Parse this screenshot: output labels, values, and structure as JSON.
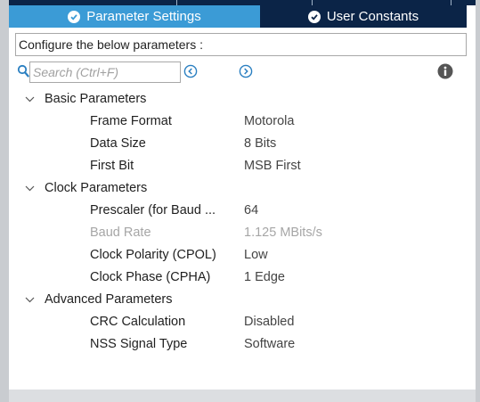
{
  "tabs": [
    {
      "label": "Parameter Settings",
      "active": true
    },
    {
      "label": "User Constants",
      "active": false
    }
  ],
  "config_label": "Configure the below parameters :",
  "search": {
    "placeholder": "Search (Ctrl+F)",
    "value": ""
  },
  "icons": {
    "search": "search-icon",
    "prev": "circle-chevron-left-icon",
    "next": "circle-chevron-right-icon",
    "info": "info-icon",
    "check": "check-circle-icon",
    "expand": "chevron-down-icon"
  },
  "colors": {
    "active_tab": "#3b9bd6",
    "inactive_tab": "#0b2447",
    "accent": "#3b9bd6",
    "disabled_text": "#a6a6a6"
  },
  "groups": [
    {
      "label": "Basic Parameters",
      "params": [
        {
          "name": "Frame Format",
          "value": "Motorola"
        },
        {
          "name": "Data Size",
          "value": "8 Bits"
        },
        {
          "name": "First Bit",
          "value": "MSB First"
        }
      ]
    },
    {
      "label": "Clock Parameters",
      "params": [
        {
          "name": "Prescaler (for Baud ...",
          "value": "64"
        },
        {
          "name": "Baud Rate",
          "value": "1.125 MBits/s",
          "disabled": true
        },
        {
          "name": "Clock Polarity (CPOL)",
          "value": "Low"
        },
        {
          "name": "Clock Phase (CPHA)",
          "value": "1 Edge"
        }
      ]
    },
    {
      "label": "Advanced Parameters",
      "params": [
        {
          "name": "CRC Calculation",
          "value": "Disabled"
        },
        {
          "name": "NSS Signal Type",
          "value": "Software"
        }
      ]
    }
  ]
}
